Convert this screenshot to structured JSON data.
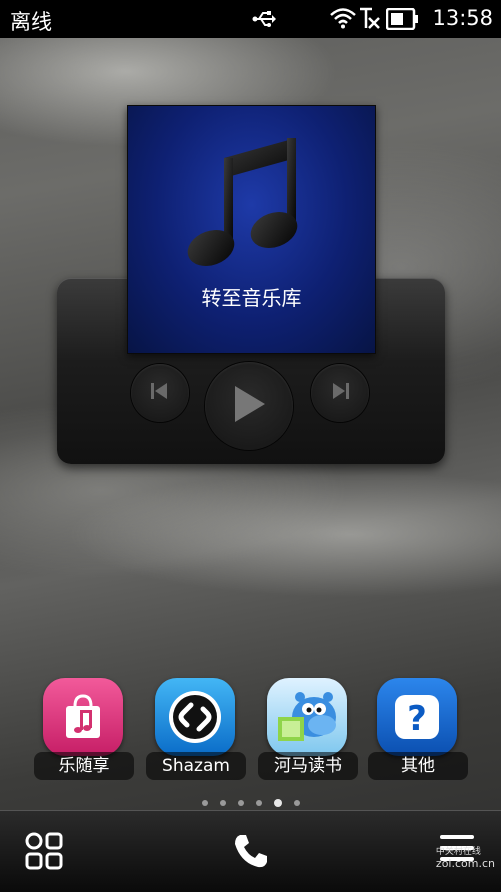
{
  "status_bar": {
    "network_status": "离线",
    "time": "13:58",
    "icons": [
      "usb-icon",
      "wifi-icon",
      "no-signal-icon",
      "battery-icon"
    ]
  },
  "music_widget": {
    "label": "转至音乐库",
    "controls": [
      "previous-icon",
      "play-icon",
      "next-icon"
    ]
  },
  "apps": [
    {
      "label": "乐随享",
      "icon": "shopping-bag-music-icon",
      "color": "#e0307a"
    },
    {
      "label": "Shazam",
      "icon": "shazam-icon",
      "color": "#1587d8"
    },
    {
      "label": "河马读书",
      "icon": "hippo-reader-icon",
      "color": "#39a3e0"
    },
    {
      "label": "其他",
      "icon": "question-icon",
      "color": "#0e5fc4"
    }
  ],
  "page_indicator": {
    "count": 6,
    "active": 5
  },
  "bottom_bar": {
    "icons": [
      "apps-grid-icon",
      "phone-icon",
      "menu-icon"
    ]
  },
  "watermark": {
    "line1": "中关村在线",
    "line2": "zol.com.cn"
  }
}
